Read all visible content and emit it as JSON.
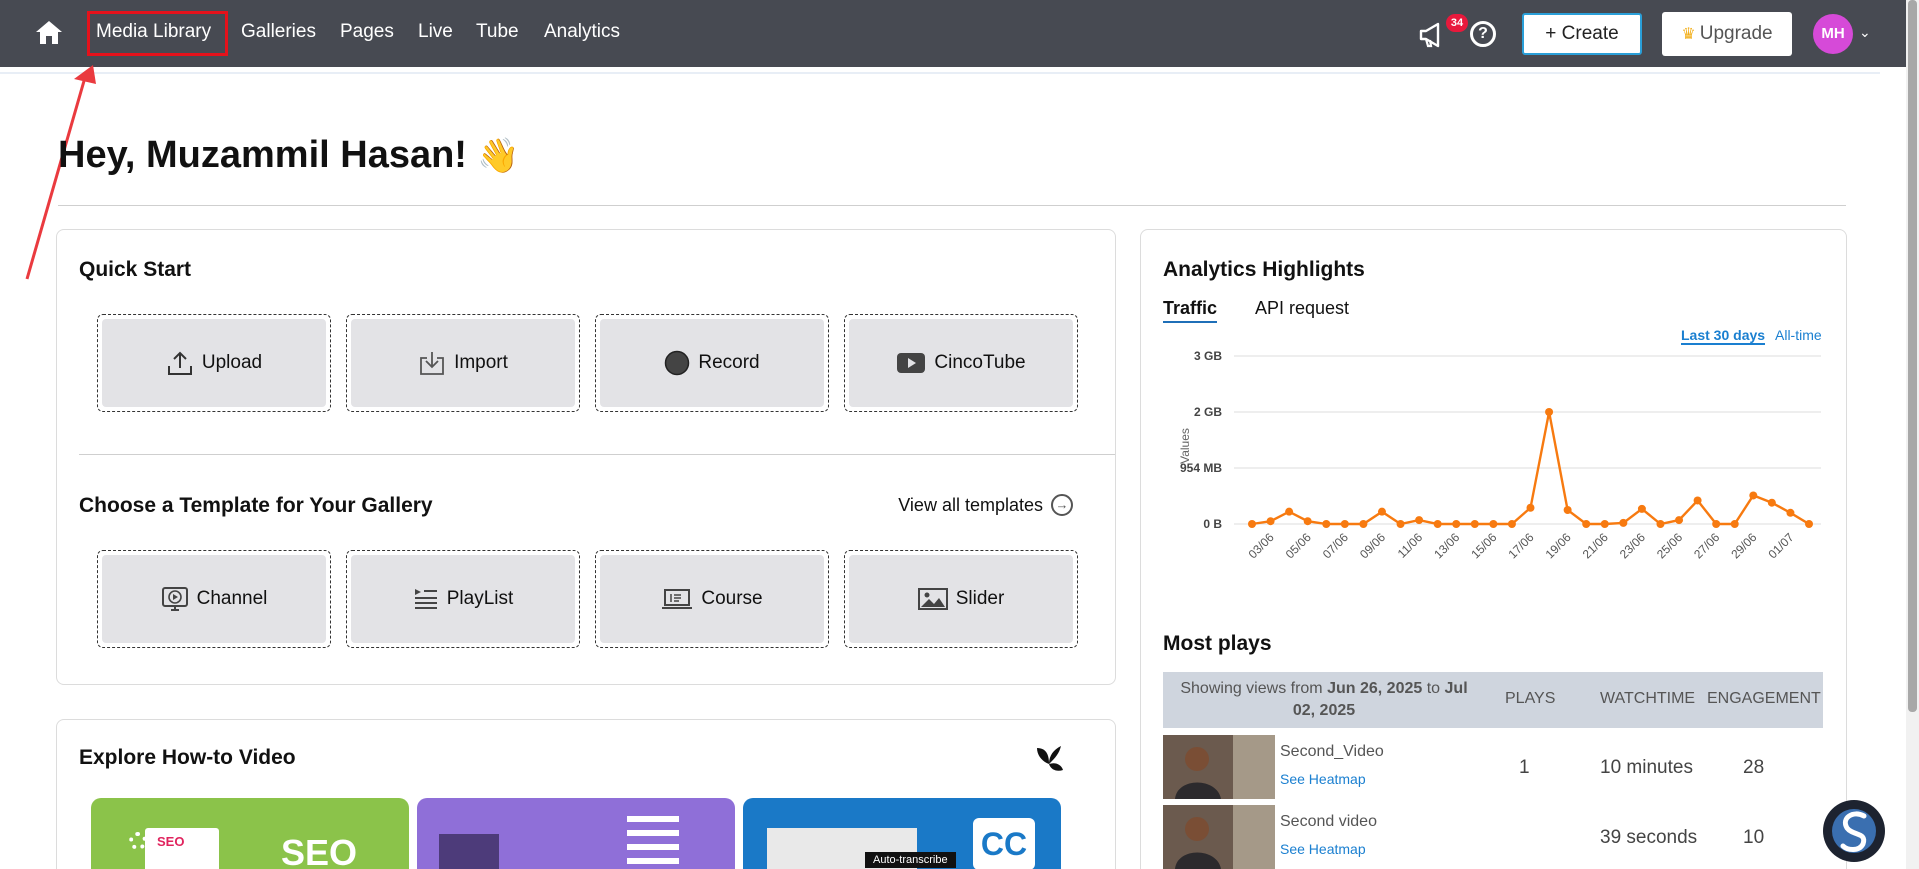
{
  "nav": {
    "items": [
      "Media Library",
      "Galleries",
      "Pages",
      "Live",
      "Tube",
      "Analytics"
    ],
    "notifications_count": "34",
    "help_symbol": "?",
    "create_label": "+ Create",
    "upgrade_label": "Upgrade",
    "avatar_initials": "MH"
  },
  "greeting": {
    "text": "Hey, Muzammil Hasan!",
    "emoji": "👋"
  },
  "quick_start": {
    "title": "Quick Start",
    "actions": [
      "Upload",
      "Import",
      "Record",
      "CincoTube"
    ],
    "template_title": "Choose a Template for Your Gallery",
    "view_all_label": "View all templates",
    "templates": [
      "Channel",
      "PlayList",
      "Course",
      "Slider"
    ]
  },
  "howto": {
    "title": "Explore How-to Video",
    "thumbs": [
      {
        "badge": "SEO",
        "color": "#8bc34a"
      },
      {
        "badge": "",
        "color": "#8f6fd8"
      },
      {
        "badge": "CC",
        "caption": "Auto-transcribe",
        "color": "#1a79c7"
      }
    ]
  },
  "analytics": {
    "title": "Analytics Highlights",
    "tabs": [
      "Traffic",
      "API request"
    ],
    "ranges": [
      "Last 30 days",
      "All-time"
    ],
    "colors": {
      "line": "#f77a10",
      "accent": "#1a7fd0"
    }
  },
  "chart_data": {
    "type": "line",
    "ylabel": "Values",
    "y_ticks": [
      "0 B",
      "954 MB",
      "2 GB",
      "3 GB"
    ],
    "ylim": [
      0,
      3
    ],
    "x_tick_labels": [
      "03/06",
      "05/06",
      "07/06",
      "09/06",
      "11/06",
      "13/06",
      "15/06",
      "17/06",
      "19/06",
      "21/06",
      "23/06",
      "25/06",
      "27/06",
      "29/06",
      "01/07"
    ],
    "x": [
      "02/06",
      "03/06",
      "04/06",
      "05/06",
      "06/06",
      "07/06",
      "08/06",
      "09/06",
      "10/06",
      "11/06",
      "12/06",
      "13/06",
      "14/06",
      "15/06",
      "16/06",
      "17/06",
      "18/06",
      "19/06",
      "20/06",
      "21/06",
      "22/06",
      "23/06",
      "24/06",
      "25/06",
      "26/06",
      "27/06",
      "28/06",
      "29/06",
      "30/06",
      "01/07",
      "02/07"
    ],
    "series": [
      {
        "values": [
          0,
          0.05,
          0.22,
          0.05,
          0,
          0,
          0,
          0.22,
          0,
          0.07,
          0,
          0,
          0,
          0,
          0,
          0.29,
          2.0,
          0.25,
          0,
          0,
          0.02,
          0.27,
          0,
          0.07,
          0.42,
          0,
          0,
          0.51,
          0.38,
          0.2,
          0
        ]
      }
    ]
  },
  "most_plays": {
    "title": "Most plays",
    "range_prefix": "Showing views from",
    "range_from": "Jun 26, 2025",
    "range_to_word": "to",
    "range_to": "Jul 02, 2025",
    "columns": [
      "PLAYS",
      "WATCHTIME",
      "ENGAGEMENT"
    ],
    "rows": [
      {
        "title": "Second_Video",
        "heatmap": "See Heatmap",
        "plays": "1",
        "watchtime": "10 minutes",
        "engagement": "28"
      },
      {
        "title": "Second video",
        "heatmap": "See Heatmap",
        "plays": "",
        "watchtime": "39 seconds",
        "engagement": "10"
      }
    ]
  }
}
